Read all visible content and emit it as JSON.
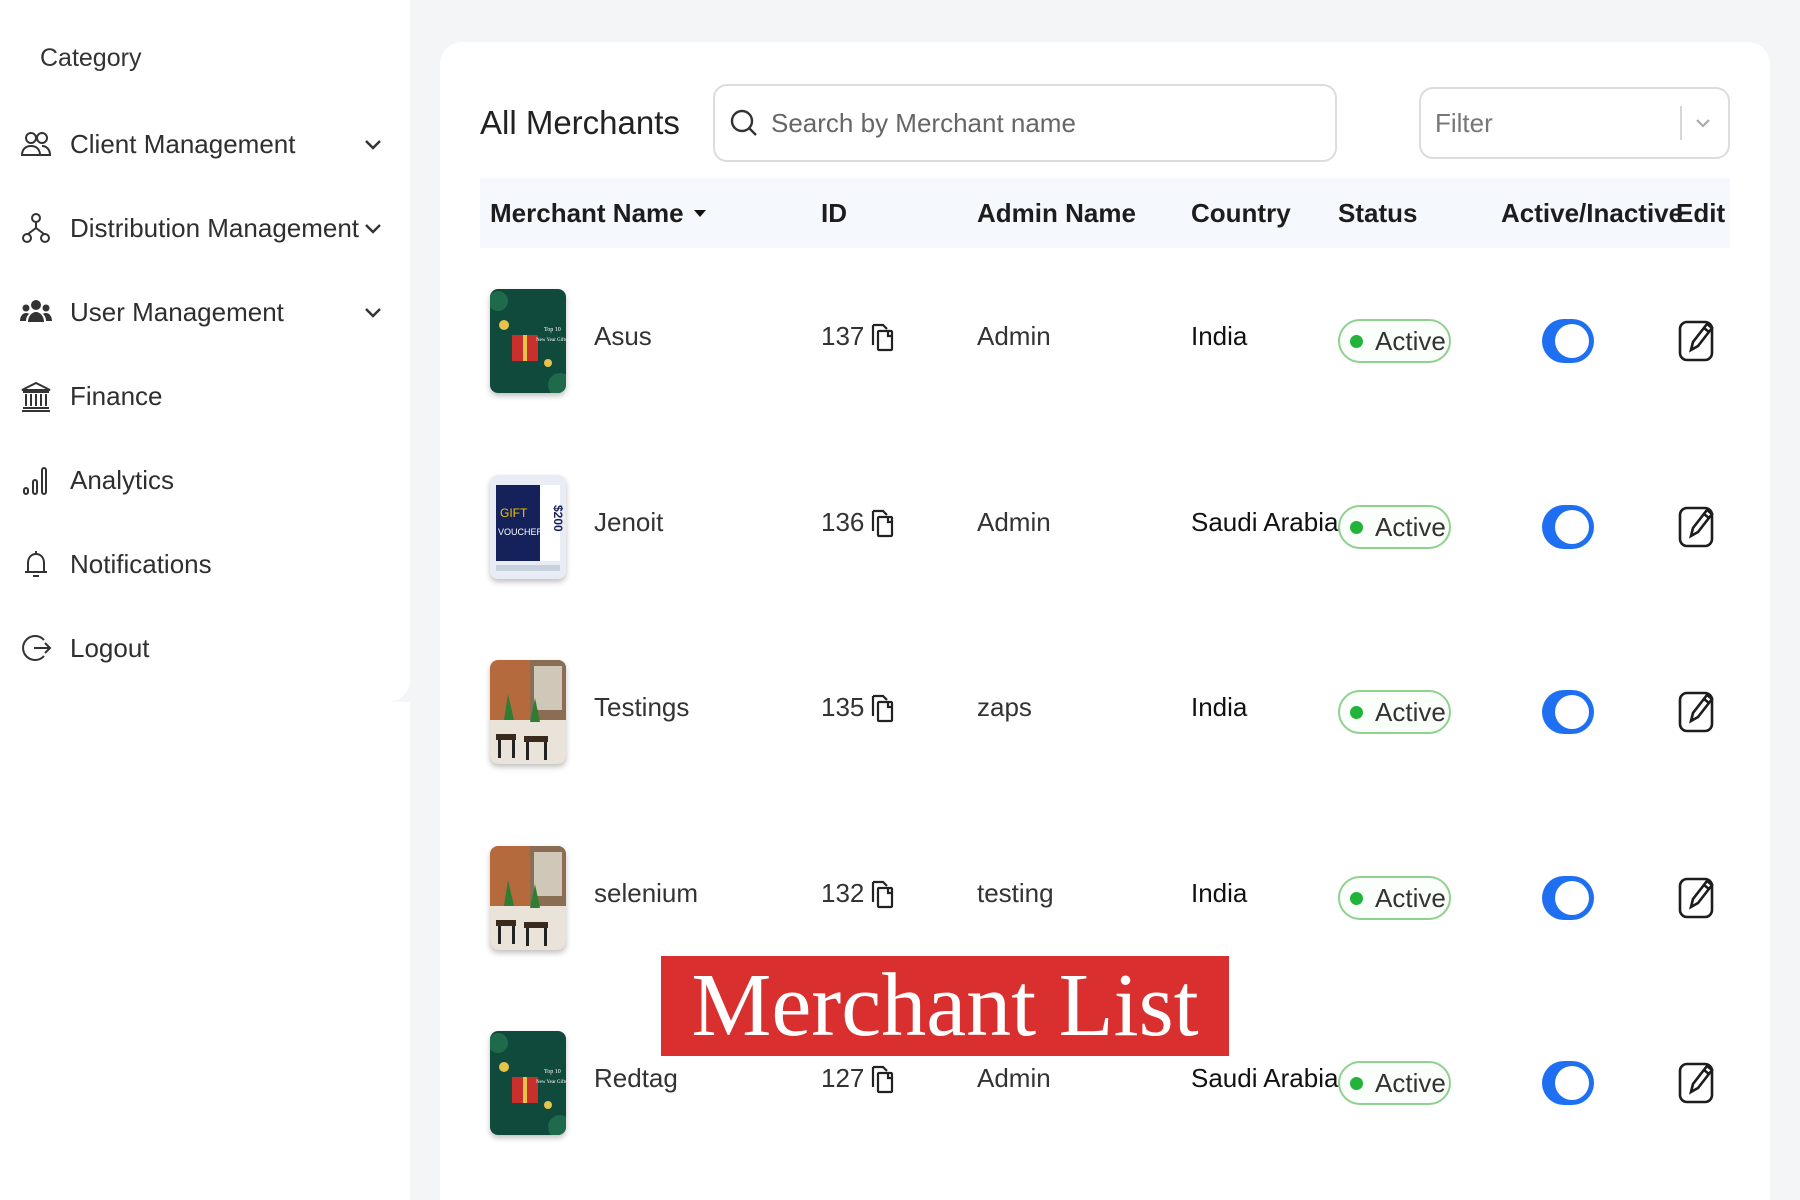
{
  "sidebar": {
    "category_title": "Category",
    "items": [
      {
        "label": "Client Management",
        "icon": "users-icon",
        "has_chevron": true
      },
      {
        "label": "Distribution Management",
        "icon": "hierarchy-icon",
        "has_chevron": true
      },
      {
        "label": "User Management",
        "icon": "user-group-icon",
        "has_chevron": true
      },
      {
        "label": "Finance",
        "icon": "bank-icon",
        "has_chevron": false
      },
      {
        "label": "Analytics",
        "icon": "bar-chart-icon",
        "has_chevron": false
      },
      {
        "label": "Notifications",
        "icon": "bell-icon",
        "has_chevron": false
      },
      {
        "label": "Logout",
        "icon": "logout-icon",
        "has_chevron": false
      }
    ]
  },
  "main": {
    "title": "All Merchants",
    "search": {
      "placeholder": "Search by Merchant name",
      "value": ""
    },
    "filter": {
      "placeholder": "Filter"
    }
  },
  "table": {
    "headers": {
      "merchant_name": "Merchant Name",
      "id": "ID",
      "admin_name": "Admin Name",
      "country": "Country",
      "status": "Status",
      "active_inactive": "Active/Inactive",
      "edit": "Edit"
    },
    "rows": [
      {
        "name": "Asus",
        "id": "137",
        "admin": "Admin",
        "country": "India",
        "status": "Active",
        "active": true,
        "thumb": "green-gift"
      },
      {
        "name": "Jenoit",
        "id": "136",
        "admin": "Admin",
        "country": "Saudi Arabia",
        "status": "Active",
        "active": true,
        "thumb": "voucher"
      },
      {
        "name": "Testings",
        "id": "135",
        "admin": "zaps",
        "country": "India",
        "status": "Active",
        "active": true,
        "thumb": "cafe"
      },
      {
        "name": "selenium",
        "id": "132",
        "admin": "testing",
        "country": "India",
        "status": "Active",
        "active": true,
        "thumb": "cafe"
      },
      {
        "name": "Redtag",
        "id": "127",
        "admin": "Admin",
        "country": "Saudi Arabia",
        "status": "Active",
        "active": true,
        "thumb": "green-gift"
      }
    ]
  },
  "thumbnail_text": {
    "gift_line1": "Top 10",
    "gift_line2": "New Year Gifts",
    "voucher_word1": "GIFT",
    "voucher_word2": "VOUCHER",
    "voucher_amount": "$200"
  },
  "caption": "Merchant List",
  "colors": {
    "accent_blue": "#1f6ff2",
    "status_green": "#22b33a",
    "caption_red": "#d9302f"
  }
}
